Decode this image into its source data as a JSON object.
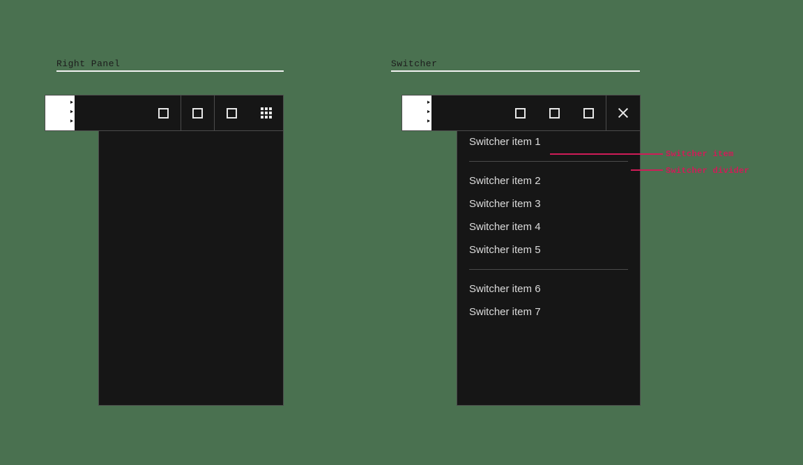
{
  "canvas": {
    "background_color": "#4a7150",
    "panel_color": "#161616",
    "panel_border_color": "#4c4c4c",
    "annotation_color": "#d01c58",
    "rule_color": "#f2f2f2"
  },
  "sections": [
    {
      "id": "right-panel",
      "label": "Right Panel"
    },
    {
      "id": "switcher",
      "label": "Switcher"
    }
  ],
  "right_panel": {
    "header": {
      "buttons": [
        {
          "icon": "square-icon",
          "name": "square-button-1"
        },
        {
          "icon": "square-icon",
          "name": "square-button-2"
        },
        {
          "icon": "square-icon",
          "name": "square-button-3"
        },
        {
          "icon": "grid-icon",
          "name": "app-switcher-button"
        }
      ]
    }
  },
  "switcher_panel": {
    "header": {
      "buttons": [
        {
          "icon": "square-icon",
          "name": "square-button-1"
        },
        {
          "icon": "square-icon",
          "name": "square-button-2"
        },
        {
          "icon": "square-icon",
          "name": "square-button-3"
        },
        {
          "icon": "close-icon",
          "name": "close-button"
        }
      ]
    },
    "items": [
      {
        "label": "Switcher item 1"
      },
      {
        "label": "Switcher item 2"
      },
      {
        "label": "Switcher item 3"
      },
      {
        "label": "Switcher item 4"
      },
      {
        "label": "Switcher item 5"
      },
      {
        "label": "Switcher item 6"
      },
      {
        "label": "Switcher item 7"
      }
    ]
  },
  "annotations": [
    {
      "id": "anno-item",
      "label": "Switcher item"
    },
    {
      "id": "anno-divider",
      "label": "Switcher divider"
    }
  ]
}
